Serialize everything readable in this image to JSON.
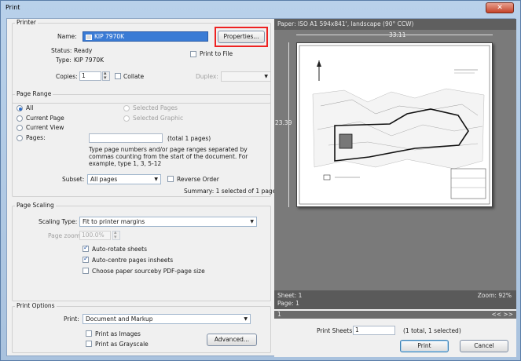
{
  "window": {
    "title": "Print",
    "close_glyph": "✕"
  },
  "printer": {
    "legend": "Printer",
    "name_label": "Name:",
    "name_value": "KIP 7970K",
    "properties_label": "Properties...",
    "status_label": "Status:",
    "status_value": "Ready",
    "type_label": "Type:",
    "type_value": "KIP 7970K",
    "print_to_file_label": "Print to File",
    "copies_label": "Copies:",
    "copies_value": "1",
    "collate_label": "Collate",
    "duplex_label": "Duplex:"
  },
  "page_range": {
    "legend": "Page Range",
    "all": "All",
    "current_page": "Current Page",
    "current_view": "Current View",
    "pages": "Pages:",
    "selected_pages": "Selected Pages",
    "selected_graphic": "Selected Graphic",
    "total_pages": "(total 1 pages)",
    "help_text": "Type page numbers and/or page ranges separated by commas counting from the start of the document. For example, type 1, 3, 5-12",
    "subset_label": "Subset:",
    "subset_value": "All pages",
    "reverse_order": "Reverse Order",
    "summary": "Summary: 1 selected of 1 pages"
  },
  "page_scaling": {
    "legend": "Page Scaling",
    "scaling_type_label": "Scaling Type:",
    "scaling_type_value": "Fit to printer margins",
    "page_zoom_label": "Page zoom:",
    "page_zoom_value": "100.0%",
    "auto_rotate": "Auto-rotate sheets",
    "auto_centre": "Auto-centre pages insheets",
    "choose_source": "Choose paper sourceby PDF-page size"
  },
  "print_options": {
    "legend": "Print Options",
    "print_label": "Print:",
    "print_value": "Document and Markup",
    "print_as_images": "Print as Images",
    "print_as_grayscale": "Print as Grayscale",
    "advanced_label": "Advanced..."
  },
  "preview": {
    "paper_info": "Paper: ISO A1 594x841', landscape (90° CCW)",
    "width_dim": "33.11",
    "height_dim": "23.39",
    "sheet": "Sheet: 1",
    "page": "Page: 1",
    "zoom": "Zoom: 92%",
    "page_indicator": "1",
    "nav_glyphs": "<< >>"
  },
  "footer": {
    "print_sheets_label": "Print Sheets:",
    "print_sheets_value": "1",
    "print_sheets_summary": "(1 total, 1 selected)",
    "print_button": "Print",
    "cancel_button": "Cancel"
  }
}
